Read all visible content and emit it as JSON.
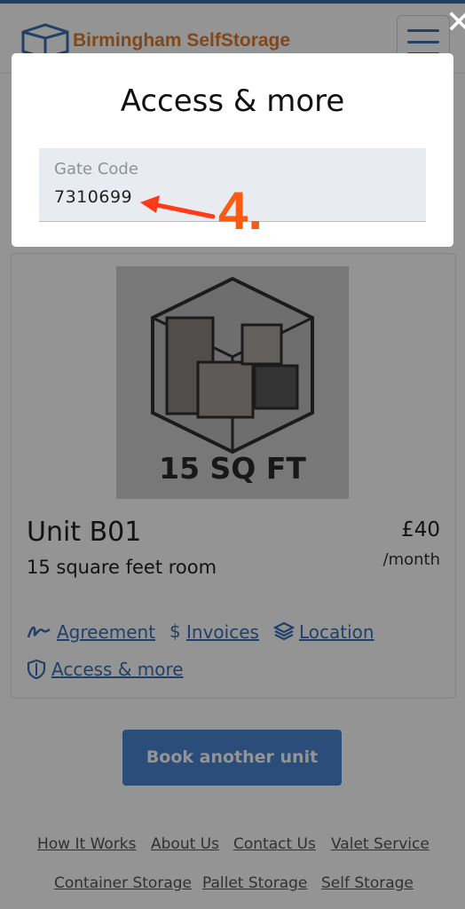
{
  "header": {
    "logo_text": "Birmingham SelfStorage",
    "logo_icon": "box-icon",
    "menu_icon": "hamburger-icon"
  },
  "unit": {
    "image_label": "15 SQ FT",
    "title": "Unit B01",
    "description": "15 square feet room",
    "price": "£40",
    "period": "/month",
    "links": [
      {
        "label": "Agreement",
        "icon": "signature-icon"
      },
      {
        "label": "Invoices",
        "icon": "dollar-icon"
      },
      {
        "label": "Location",
        "icon": "layers-icon"
      },
      {
        "label": "Access & more",
        "icon": "shield-icon"
      }
    ]
  },
  "book_button": "Book another unit",
  "footer": {
    "row1": [
      "How It Works",
      "About Us",
      "Contact Us",
      "Valet Service"
    ],
    "row2": [
      "Container Storage",
      "Pallet Storage",
      "Self Storage"
    ]
  },
  "modal": {
    "title": "Access & more",
    "field_label": "Gate Code",
    "field_value": "7310699",
    "close_icon": "close-icon"
  },
  "annotation": {
    "label": "4.",
    "color": "#ff5a12"
  },
  "colors": {
    "brand_orange": "#e07b2a",
    "link_blue": "#3a6fb0",
    "button_blue": "#4a86d0"
  }
}
